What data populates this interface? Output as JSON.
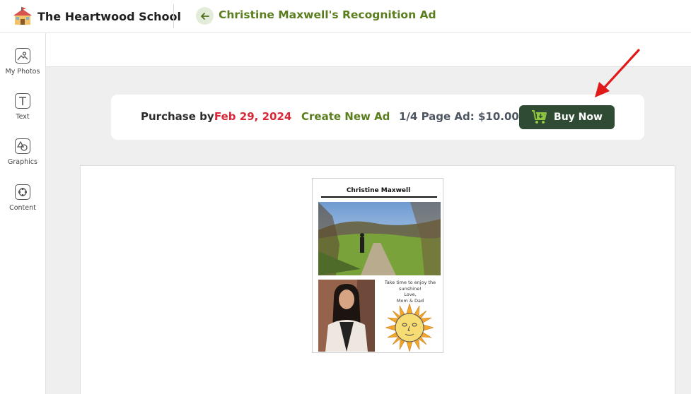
{
  "header": {
    "school_name": "The Heartwood School",
    "ad_title": "Christine Maxwell's Recognition Ad"
  },
  "sidebar": {
    "items": [
      {
        "label": "My Photos",
        "icon": "photos-icon"
      },
      {
        "label": "Text",
        "icon": "text-icon"
      },
      {
        "label": "Graphics",
        "icon": "graphics-icon"
      },
      {
        "label": "Content",
        "icon": "content-icon"
      }
    ]
  },
  "purchase_bar": {
    "label": "Purchase by:",
    "date": "Feb 29, 2024",
    "create_link": "Create New Ad",
    "price": "1/4 Page Ad: $10.00",
    "buy_label": "Buy Now"
  },
  "ad": {
    "name": "Christine Maxwell",
    "message": [
      "Take time to enjoy the",
      "sunshine!",
      "Love,",
      "Mom & Dad"
    ]
  },
  "colors": {
    "brand_green": "#5a7d1e",
    "buy_button": "#2f4b34",
    "date_red": "#d62839",
    "arrow_red": "#e0191b"
  }
}
